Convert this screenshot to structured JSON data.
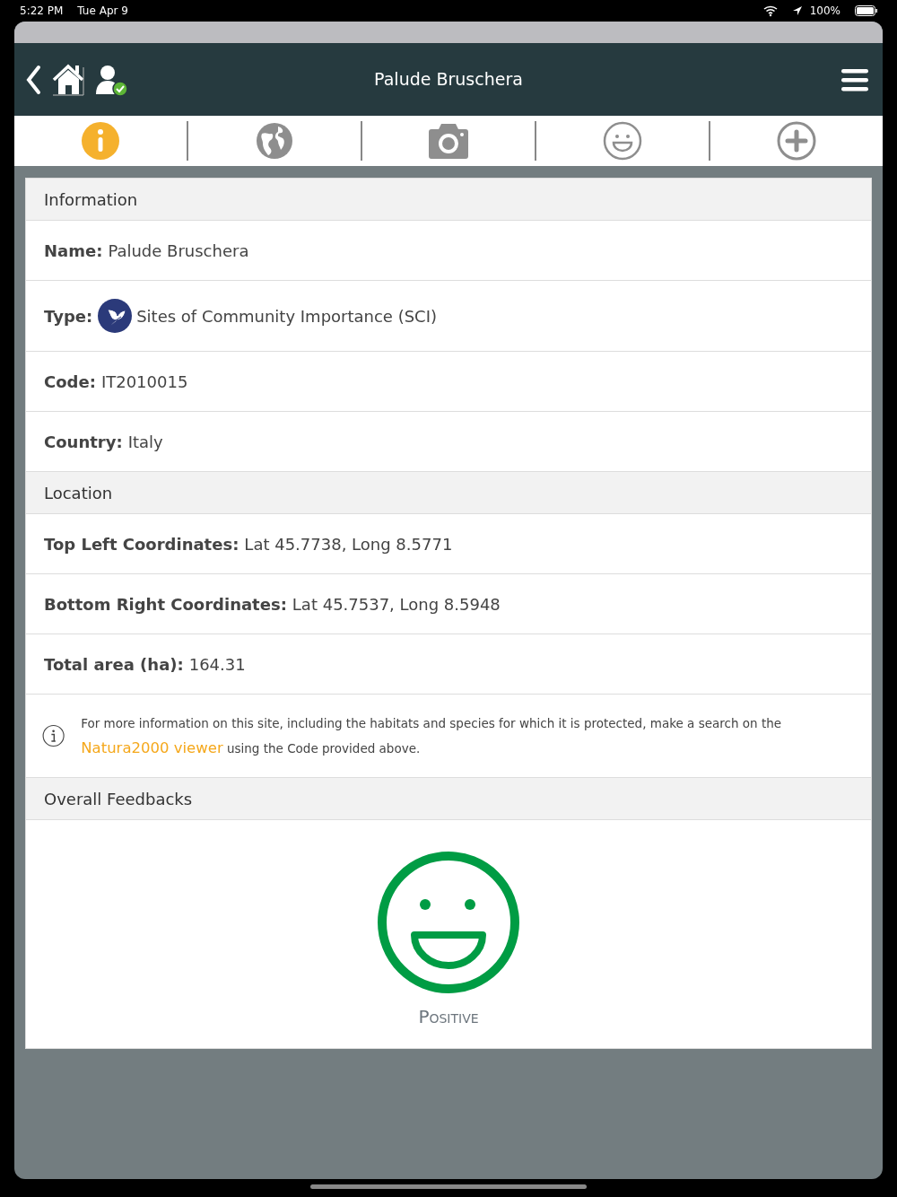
{
  "status_bar": {
    "time": "5:22 PM",
    "date": "Tue Apr 9",
    "battery": "100%"
  },
  "header": {
    "title": "Palude Bruschera"
  },
  "tabs": [
    {
      "kind": "info",
      "selected": true
    },
    {
      "kind": "globe",
      "selected": false
    },
    {
      "kind": "camera",
      "selected": false
    },
    {
      "kind": "smiley",
      "selected": false
    },
    {
      "kind": "plus",
      "selected": false
    }
  ],
  "sections": [
    {
      "title": "Information",
      "rows": [
        {
          "kind": "field",
          "label": "Name:",
          "value": "Palude Bruschera"
        },
        {
          "kind": "type",
          "label": "Type:",
          "value": "Sites of Community Importance (SCI)"
        },
        {
          "kind": "field",
          "label": "Code:",
          "value": "IT2010015"
        },
        {
          "kind": "field",
          "label": "Country:",
          "value": "Italy"
        }
      ]
    },
    {
      "title": "Location",
      "rows": [
        {
          "kind": "field",
          "label": "Top Left Coordinates:",
          "value": "Lat 45.7738, Long 8.5771"
        },
        {
          "kind": "field",
          "label": "Bottom Right Coordinates:",
          "value": "Lat 45.7537, Long 8.5948"
        },
        {
          "kind": "field",
          "label": "Total area (ha):",
          "value": "164.31"
        },
        {
          "kind": "note",
          "text": "For more information on this site, including the habitats and species for which it is protected, make a search on the",
          "link": "Natura2000 viewer",
          "after": "using the Code provided above."
        }
      ]
    },
    {
      "title": "Overall Feedbacks",
      "rows": [
        {
          "kind": "feedback",
          "label": "Positive"
        }
      ]
    }
  ]
}
